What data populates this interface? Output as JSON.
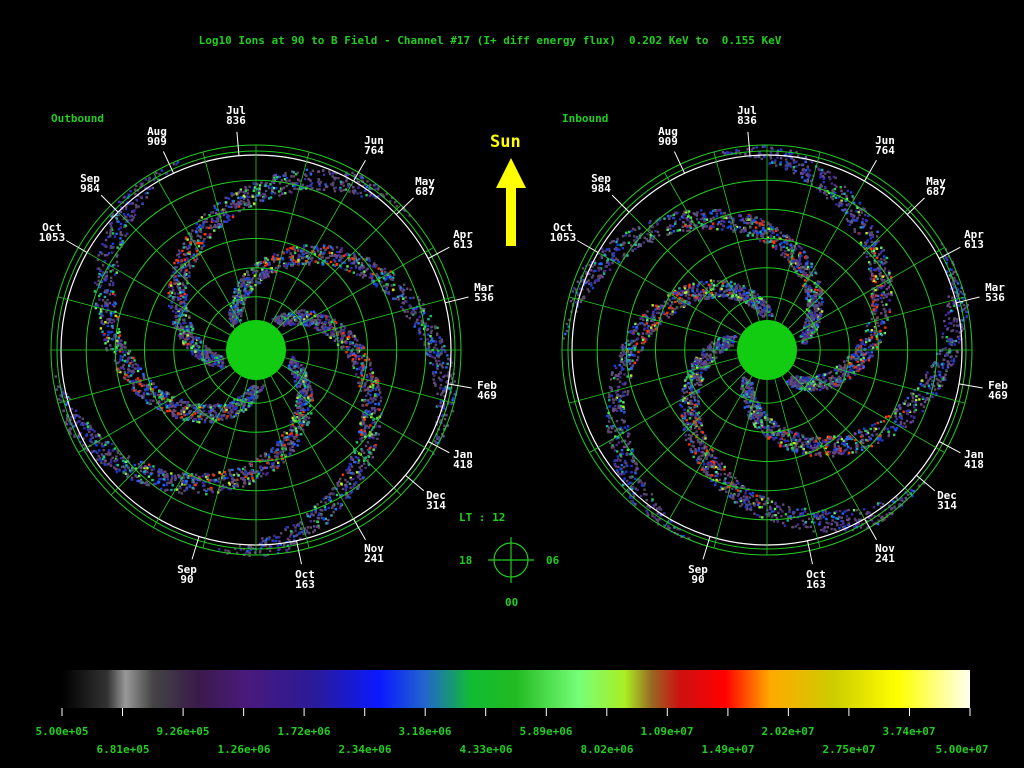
{
  "title": "Log10 Ions at 90 to B Field - Channel #17 (I+ diff energy flux)  0.202 KeV to  0.155 KeV",
  "panels": [
    {
      "id": "outbound",
      "label": "Outbound",
      "center": [
        256,
        350
      ],
      "months": [
        {
          "m": "Oct",
          "n": "1053",
          "ang": -60
        },
        {
          "m": "Sep",
          "n": "984",
          "ang": -45
        },
        {
          "m": "Aug",
          "n": "909",
          "ang": -25
        },
        {
          "m": "Jul",
          "n": "836",
          "ang": -5
        },
        {
          "m": "Jun",
          "n": "764",
          "ang": 30
        },
        {
          "m": "May",
          "n": "687",
          "ang": 46
        },
        {
          "m": "Apr",
          "n": "613",
          "ang": 62
        },
        {
          "m": "Mar",
          "n": "536",
          "ang": 76
        },
        {
          "m": "Feb",
          "n": "469",
          "ang": 100
        },
        {
          "m": "Jan",
          "n": "418",
          "ang": 118
        },
        {
          "m": "Dec",
          "n": "314",
          "ang": 130
        },
        {
          "m": "Nov",
          "n": "241",
          "ang": 150
        },
        {
          "m": "Oct",
          "n": "163",
          "ang": 168
        },
        {
          "m": "Sep",
          "n": "90",
          "ang": 197
        }
      ]
    },
    {
      "id": "inbound",
      "label": "Inbound",
      "center": [
        767,
        350
      ],
      "months": [
        {
          "m": "Oct",
          "n": "1053",
          "ang": -60
        },
        {
          "m": "Sep",
          "n": "984",
          "ang": -45
        },
        {
          "m": "Aug",
          "n": "909",
          "ang": -25
        },
        {
          "m": "Jul",
          "n": "836",
          "ang": -5
        },
        {
          "m": "Jun",
          "n": "764",
          "ang": 30
        },
        {
          "m": "May",
          "n": "687",
          "ang": 46
        },
        {
          "m": "Apr",
          "n": "613",
          "ang": 62
        },
        {
          "m": "Mar",
          "n": "536",
          "ang": 76
        },
        {
          "m": "Feb",
          "n": "469",
          "ang": 100
        },
        {
          "m": "Jan",
          "n": "418",
          "ang": 118
        },
        {
          "m": "Dec",
          "n": "314",
          "ang": 130
        },
        {
          "m": "Nov",
          "n": "241",
          "ang": 150
        },
        {
          "m": "Oct",
          "n": "163",
          "ang": 168
        },
        {
          "m": "Sep",
          "n": "90",
          "ang": 197
        }
      ]
    }
  ],
  "sun": {
    "label": "Sun",
    "color": "#ffff00"
  },
  "lt_dial": {
    "label": "LT : 12",
    "left": "18",
    "right": "06",
    "bottom": "00"
  },
  "chart_data": {
    "type": "heatmap",
    "title": "Log10 Ions at 90 to B Field - Channel #17 (I+ diff energy flux)  0.202 KeV to  0.155 KeV",
    "panels": [
      "Outbound",
      "Inbound"
    ],
    "colorbar": {
      "min": 500000,
      "max": 50000000,
      "scale": "log",
      "ticks_top": [
        "5.00e+05",
        "9.26e+05",
        "1.72e+06",
        "3.18e+06",
        "5.89e+06",
        "1.09e+07",
        "2.02e+07",
        "3.74e+07"
      ],
      "ticks_bottom": [
        "6.81e+05",
        "1.26e+06",
        "2.34e+06",
        "4.33e+06",
        "8.02e+06",
        "1.49e+07",
        "2.75e+07",
        "5.00e+07"
      ]
    }
  },
  "colors": {
    "grid": "#22cc22",
    "text_green": "#22cc22",
    "planet": "#11cc11",
    "outer_ring": "#ffffff"
  }
}
